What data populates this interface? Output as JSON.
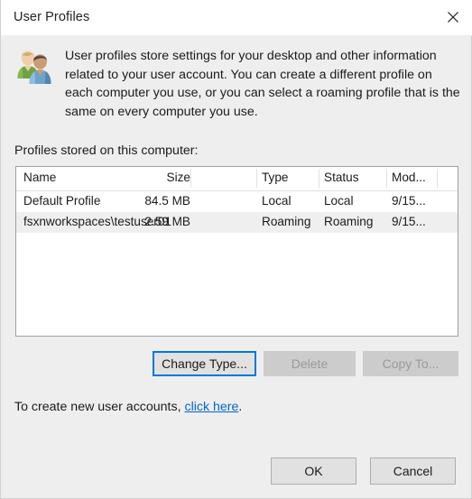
{
  "window": {
    "title": "User Profiles",
    "close_icon": "close-icon"
  },
  "header": {
    "icon": "users-icon",
    "description": "User profiles store settings for your desktop and other information related to your user account. You can create a different profile on each computer you use, or you can select a roaming profile that is the same on every computer you use."
  },
  "list": {
    "label": "Profiles stored on this computer:",
    "columns": [
      "Name",
      "Size",
      "Type",
      "Status",
      "Mod..."
    ],
    "rows": [
      {
        "name": "Default Profile",
        "size": "84.5 MB",
        "type": "Local",
        "status": "Local",
        "modified": "9/15...",
        "selected": false
      },
      {
        "name": "fsxnworkspaces\\testuser01",
        "size": "2.59 MB",
        "type": "Roaming",
        "status": "Roaming",
        "modified": "9/15...",
        "selected": true
      }
    ]
  },
  "actions": {
    "change_type": "Change Type...",
    "change_type_pre": "Chan",
    "change_type_accel": "g",
    "change_type_post": "e Type...",
    "delete": "Delete",
    "copy_to": "Copy To..."
  },
  "link_line": {
    "prefix": "To create new user accounts, ",
    "link": "click here",
    "suffix": "."
  },
  "footer": {
    "ok": "OK",
    "cancel": "Cancel"
  },
  "colors": {
    "dialog_background": "#eeeeee",
    "titlebar_background": "#ffffff",
    "accent_focus": "#0078d7",
    "link": "#0066cc",
    "selected_row": "#efefef",
    "button_face": "#e1e1e1",
    "button_disabled": "#cccccc"
  }
}
